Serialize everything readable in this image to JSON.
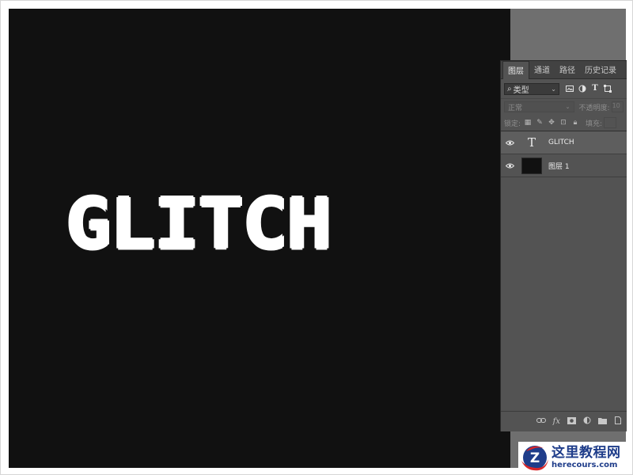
{
  "canvas": {
    "text": "GLITCH"
  },
  "layers_panel": {
    "tabs": [
      {
        "label": "图层",
        "active": true
      },
      {
        "label": "通道",
        "active": false
      },
      {
        "label": "路径",
        "active": false
      },
      {
        "label": "历史记录",
        "active": false
      }
    ],
    "filter_kind": "类型",
    "filter_icons": [
      "image-filter-icon",
      "adjustment-filter-icon",
      "type-filter-icon",
      "shape-filter-icon"
    ],
    "blend_mode": "正常",
    "opacity_label": "不透明度:",
    "opacity_value": "10",
    "lock_label": "锁定:",
    "fill_label": "填充:",
    "layers": [
      {
        "name": "GLITCH",
        "type": "text",
        "visible": true,
        "thumb_glyph": "T"
      },
      {
        "name": "图层 1",
        "type": "pixel",
        "visible": true
      }
    ],
    "footer_icons": [
      "link-icon",
      "fx-icon",
      "mask-icon",
      "adjustment-icon",
      "folder-icon",
      "new-layer-icon"
    ],
    "footer_fx_label": "fx"
  },
  "watermark": {
    "title": "这里教程网",
    "url": "herecours.com",
    "logo_letter": "Z"
  },
  "colors": {
    "canvas_bg": "#111111",
    "panel_bg": "#535353",
    "workspace_bg": "#6f6f6f",
    "text": "#ffffff",
    "watermark_blue": "#1f3d8a",
    "watermark_red": "#d8262a"
  }
}
